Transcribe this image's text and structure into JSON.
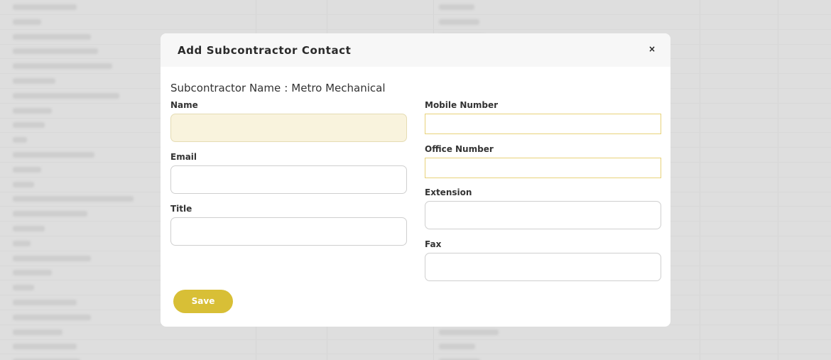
{
  "modal": {
    "title": "Add Subcontractor Contact",
    "close_glyph": "×",
    "subcontractor_label": "Subcontractor Name",
    "subcontractor_sep": ":",
    "subcontractor_value": "Metro Mechanical"
  },
  "form": {
    "name": {
      "label": "Name",
      "value": ""
    },
    "email": {
      "label": "Email",
      "value": ""
    },
    "title": {
      "label": "Title",
      "value": ""
    },
    "mobile": {
      "label": "Mobile Number",
      "value": ""
    },
    "office": {
      "label": "Office Number",
      "value": ""
    },
    "extension": {
      "label": "Extension",
      "value": ""
    },
    "fax": {
      "label": "Fax",
      "value": ""
    }
  },
  "actions": {
    "save_label": "Save"
  },
  "colors": {
    "accent": "#d8bf36",
    "name_field_fill": "#f9f3dd",
    "phone_field_border": "#e8d27a"
  }
}
